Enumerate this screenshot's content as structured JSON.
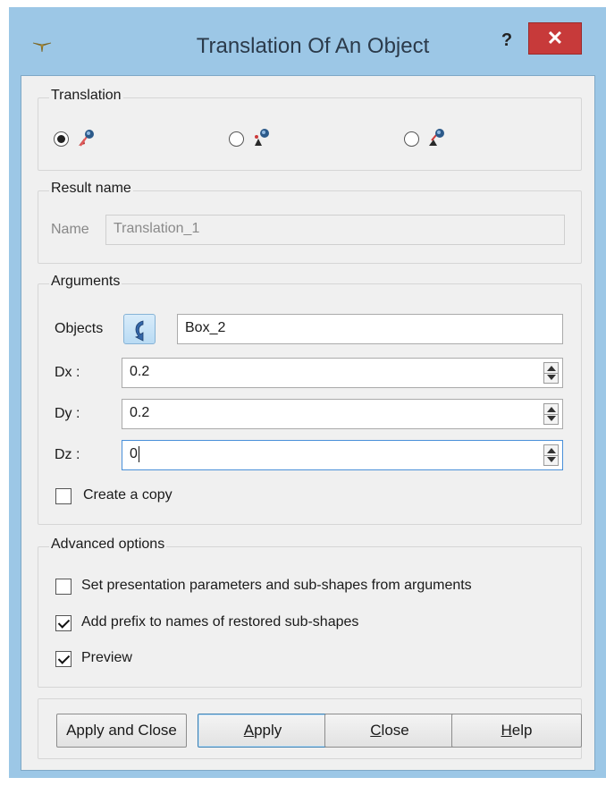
{
  "window": {
    "title": "Translation Of An Object",
    "help_label": "?",
    "close_label": "✕"
  },
  "translation_group": {
    "title": "Translation",
    "options": [
      {
        "icon": "translate-by-vector-icon",
        "selected": true
      },
      {
        "icon": "translate-by-two-points-icon",
        "selected": false
      },
      {
        "icon": "translate-by-vector-distance-icon",
        "selected": false
      }
    ]
  },
  "result_group": {
    "title": "Result name",
    "name_label": "Name",
    "name_value": "Translation_1"
  },
  "arguments_group": {
    "title": "Arguments",
    "objects_label": "Objects",
    "objects_value": "Box_2",
    "dx_label": "Dx :",
    "dx_value": "0.2",
    "dy_label": "Dy :",
    "dy_value": "0.2",
    "dz_label": "Dz :",
    "dz_value": "0",
    "create_copy_label": "Create a copy",
    "create_copy_checked": false
  },
  "advanced_group": {
    "title": "Advanced options",
    "set_presentation_label": "Set presentation parameters and sub-shapes from arguments",
    "set_presentation_checked": false,
    "add_prefix_label": "Add prefix to names of restored sub-shapes",
    "add_prefix_checked": true,
    "preview_label": "Preview",
    "preview_checked": true
  },
  "buttons": {
    "apply_and_close": "Apply and Close",
    "apply_a": "A",
    "apply_rest": "pply",
    "close_c": "C",
    "close_rest": "lose",
    "help_h": "H",
    "help_rest": "elp"
  },
  "colors": {
    "frame": "#9cc7e6",
    "close_button": "#c73a3a",
    "dialog_bg": "#f0f0f0"
  }
}
